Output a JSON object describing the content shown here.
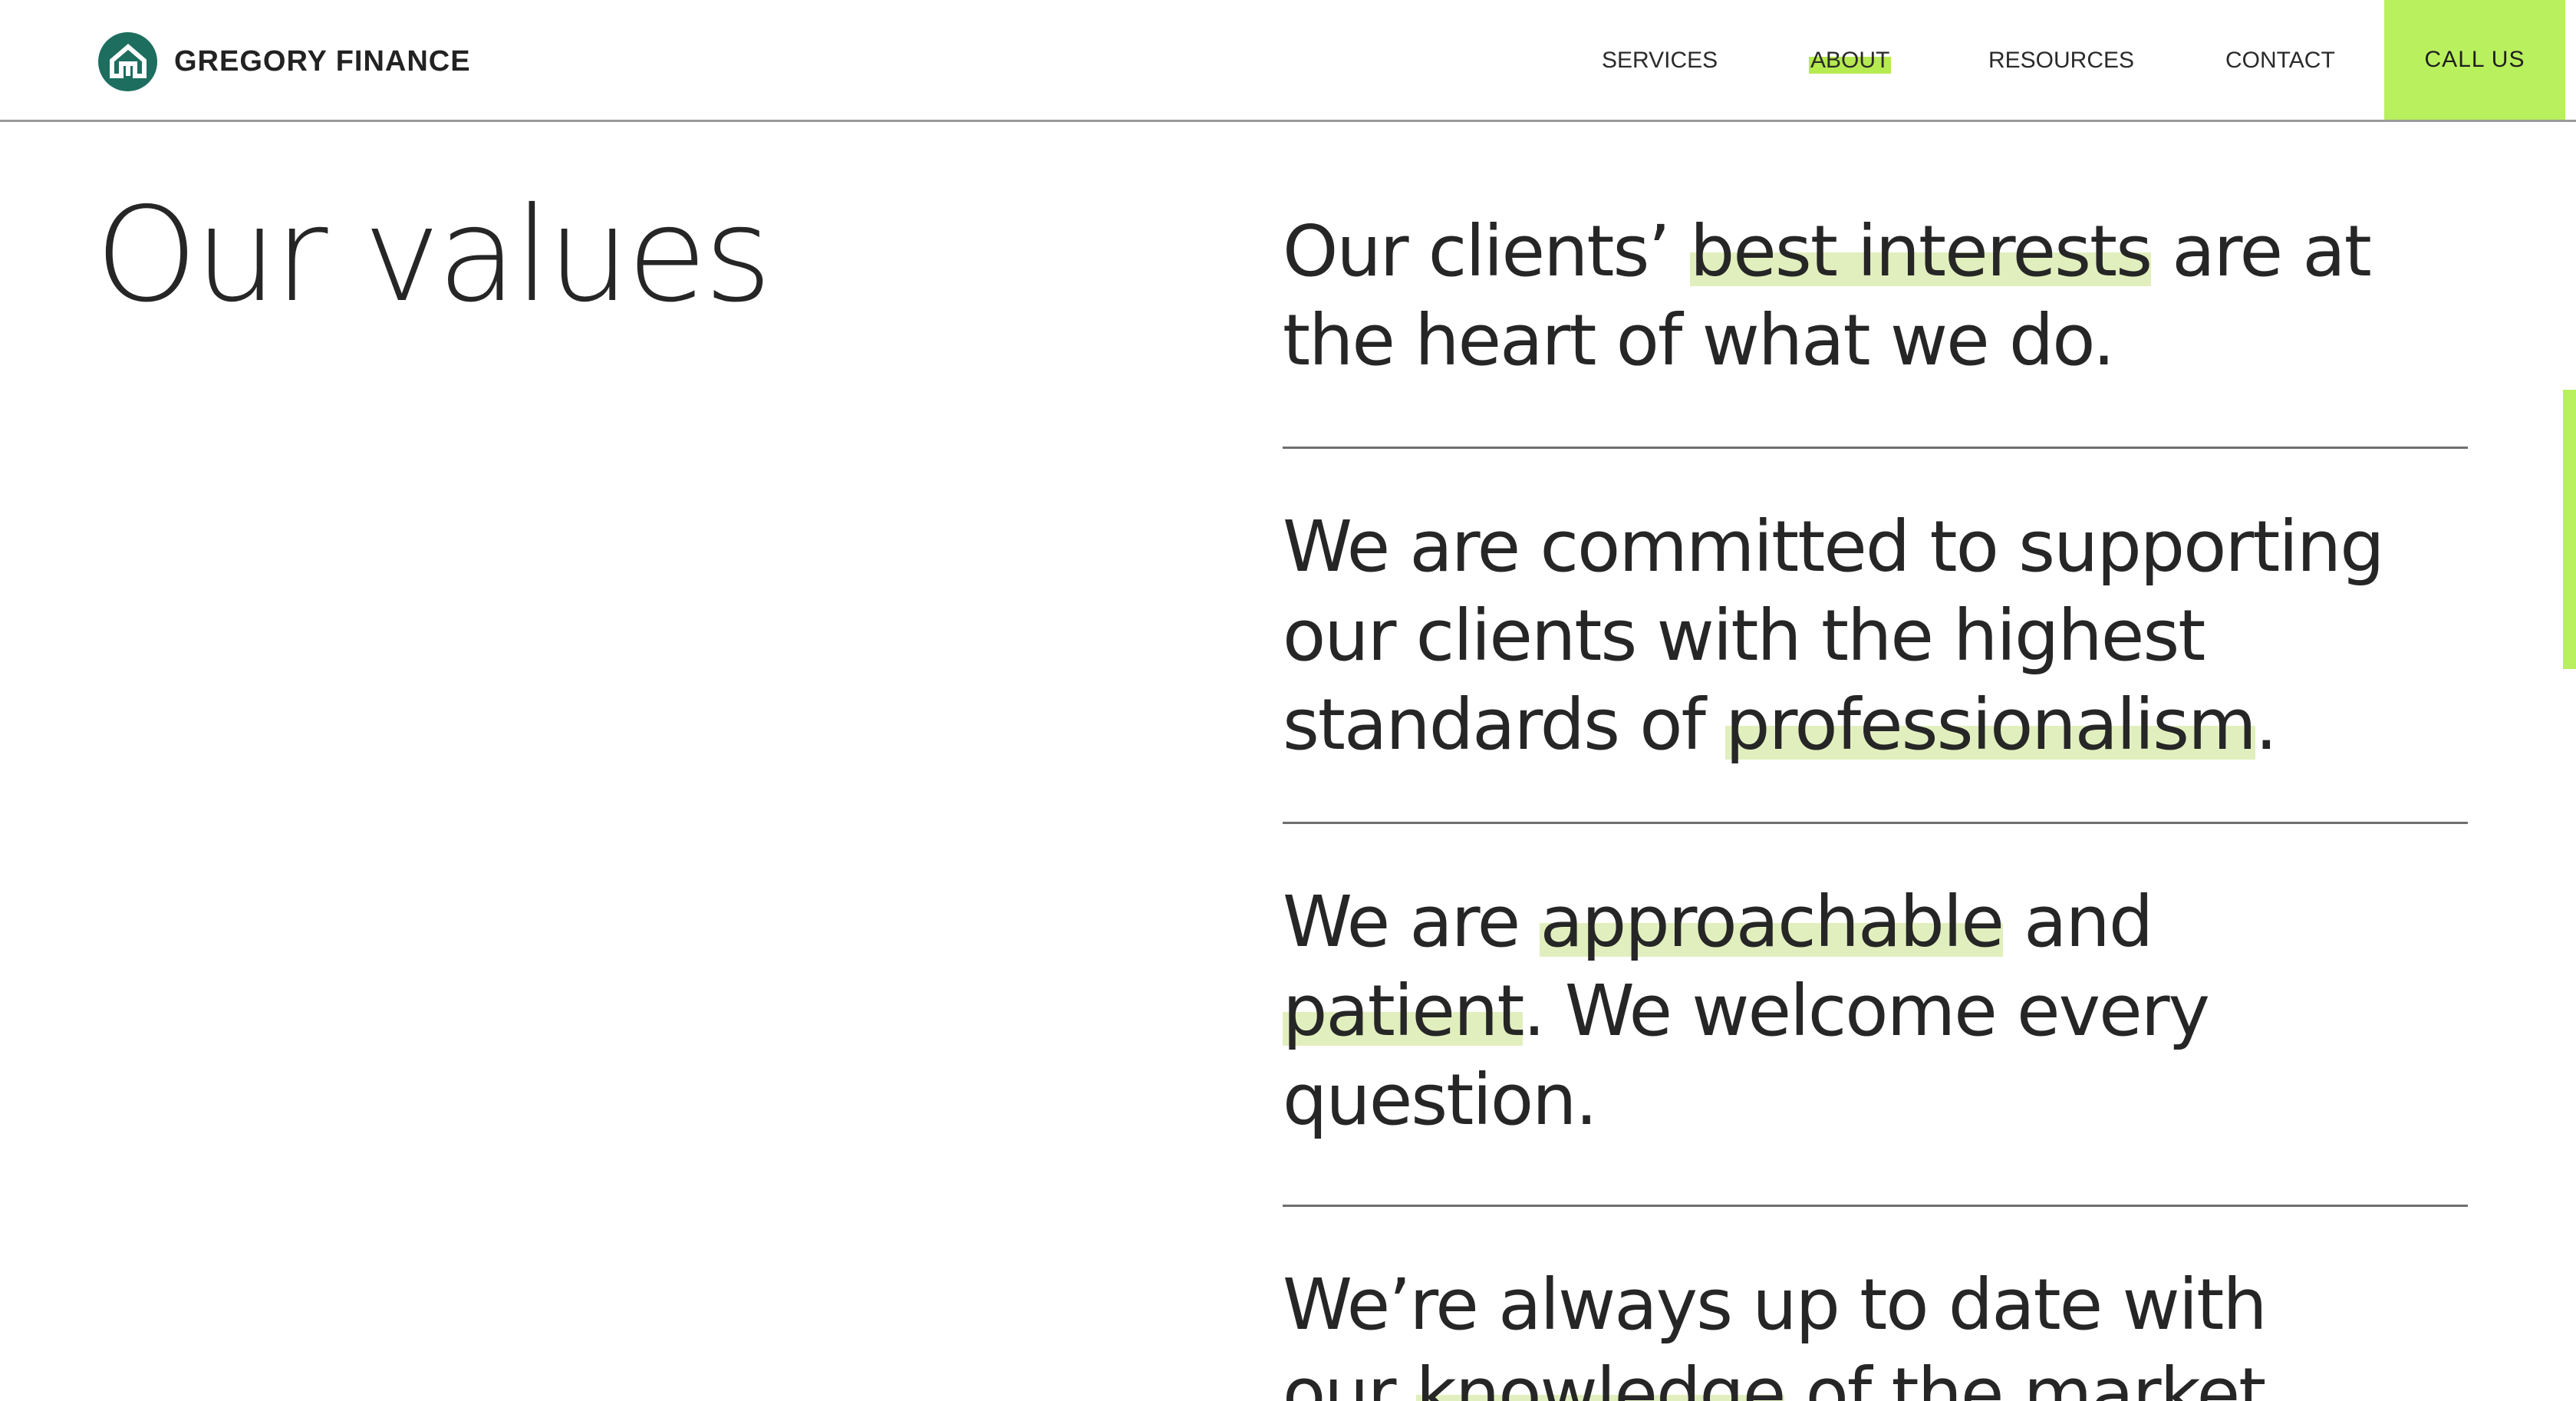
{
  "header": {
    "brand_name": "GREGORY FINANCE",
    "logo_icon": "house-circle-logo-icon",
    "nav": [
      {
        "label": "SERVICES"
      },
      {
        "label": "ABOUT"
      },
      {
        "label": "RESOURCES"
      },
      {
        "label": "CONTACT"
      }
    ],
    "call_label": "CALL US"
  },
  "colors": {
    "accent": "#b9f05d",
    "highlight": "#e1efbe",
    "brand": "#1d6e5f",
    "text": "#262626"
  },
  "main": {
    "title": "Our values",
    "values": [
      {
        "parts": [
          {
            "t": "Our clients’ ",
            "hl": false
          },
          {
            "t": "best interests",
            "hl": true
          },
          {
            "t": " are at the heart of what we do.",
            "hl": false
          }
        ]
      },
      {
        "parts": [
          {
            "t": "We are committed to supporting our clients with the highest standards of ",
            "hl": false
          },
          {
            "t": "professionalism",
            "hl": true
          },
          {
            "t": ".",
            "hl": false
          }
        ]
      },
      {
        "parts": [
          {
            "t": "We are ",
            "hl": false
          },
          {
            "t": "approachable",
            "hl": true
          },
          {
            "t": " and ",
            "hl": false
          },
          {
            "t": "patient",
            "hl": true
          },
          {
            "t": ". We welcome every question.",
            "hl": false
          }
        ]
      },
      {
        "parts": [
          {
            "t": "We’re always up to date with our ",
            "hl": false
          },
          {
            "t": "knowledge",
            "hl": true
          },
          {
            "t": " of the market.",
            "hl": false
          }
        ]
      }
    ]
  }
}
